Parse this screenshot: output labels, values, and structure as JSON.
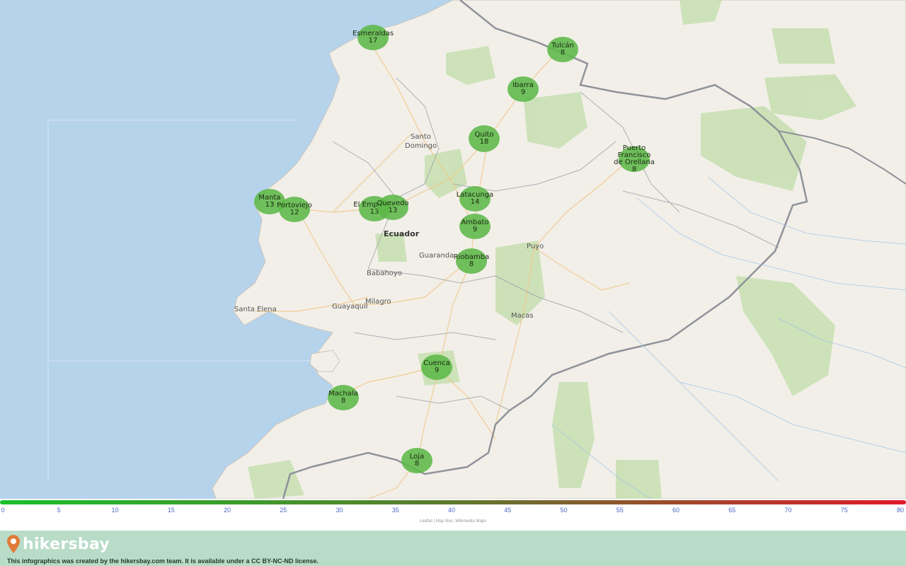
{
  "map": {
    "country_label": "Ecuador",
    "place_labels": [
      {
        "id": "santo",
        "text": "Santo"
      },
      {
        "id": "domingo",
        "text": "Domingo"
      },
      {
        "id": "guaranda",
        "text": "Guaranda"
      },
      {
        "id": "babahoyo",
        "text": "Babahoyo"
      },
      {
        "id": "milagro",
        "text": "Milagro"
      },
      {
        "id": "guayaquil",
        "text": "Guayaquil"
      },
      {
        "id": "santa-elena",
        "text": "Santa Elena"
      },
      {
        "id": "puyo",
        "text": "Puyo"
      },
      {
        "id": "macas",
        "text": "Macas"
      }
    ],
    "markers": [
      {
        "id": "esmeraldas",
        "name": "Esmeraldas",
        "value": "17"
      },
      {
        "id": "tulcan",
        "name": "Tulcán",
        "value": "8"
      },
      {
        "id": "ibarra",
        "name": "Ibarra",
        "value": "9"
      },
      {
        "id": "quito",
        "name": "Quito",
        "value": "18"
      },
      {
        "id": "puerto-francisco",
        "name": "Puerto Francisco de Orellana",
        "value": "8"
      },
      {
        "id": "manta",
        "name": "Manta",
        "value": "13"
      },
      {
        "id": "portoviejo",
        "name": "Portoviejo",
        "value": "12"
      },
      {
        "id": "el-empalme",
        "name": "El Empalme",
        "value": "13"
      },
      {
        "id": "quevedo",
        "name": "Quevedo",
        "value": "13"
      },
      {
        "id": "latacunga",
        "name": "Latacunga",
        "value": "14"
      },
      {
        "id": "ambato",
        "name": "Ambato",
        "value": "9"
      },
      {
        "id": "riobamba",
        "name": "Riobamba",
        "value": "8"
      },
      {
        "id": "cuenca",
        "name": "Cuenca",
        "value": "9"
      },
      {
        "id": "machala",
        "name": "Machala",
        "value": "8"
      },
      {
        "id": "loja",
        "name": "Loja",
        "value": "8"
      }
    ]
  },
  "scale": {
    "ticks": [
      "0",
      "5",
      "10",
      "15",
      "20",
      "25",
      "30",
      "35",
      "40",
      "45",
      "50",
      "55",
      "60",
      "65",
      "70",
      "75",
      "80"
    ],
    "colors": {
      "low": "#19c02a",
      "mid": "#5d7a2e",
      "high": "#e0192a"
    }
  },
  "attribution": "Leaflet | Map tiles: Wikimedia Maps",
  "footer": {
    "brand": "hikersbay",
    "license": "This infographics was created by the hikersbay.com team. It is available under a CC BY-NC-ND license."
  }
}
